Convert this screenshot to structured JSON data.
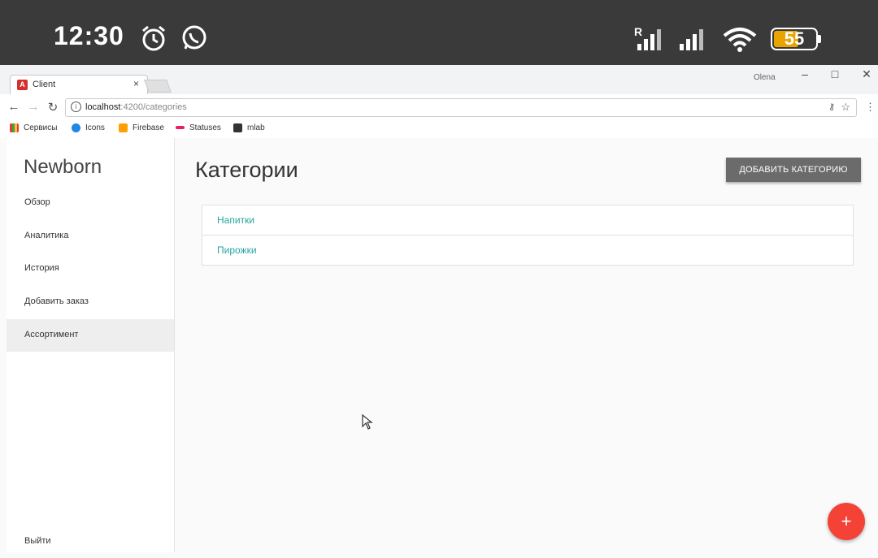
{
  "status_bar": {
    "time": "12:30",
    "battery": "55",
    "icons": [
      "alarm-icon",
      "whatsapp-icon",
      "signal-r-icon",
      "signal-icon",
      "wifi-icon",
      "battery-icon"
    ],
    "battery_color": "#e9a400"
  },
  "browser": {
    "tab_title": "Client",
    "tab_close": "×",
    "window_user": "Olena",
    "url_host": "localhost",
    "url_path": ":4200/categories",
    "bookmarks": [
      "Сервисы",
      "Icons",
      "Firebase",
      "Statuses",
      "mlab"
    ]
  },
  "sidebar": {
    "brand": "Newborn",
    "items": [
      {
        "label": "Обзор"
      },
      {
        "label": "Аналитика"
      },
      {
        "label": "История"
      },
      {
        "label": "Добавить заказ"
      },
      {
        "label": "Ассортимент"
      }
    ],
    "logout": "Выйти"
  },
  "main": {
    "title": "Категории",
    "add_button": "ДОБАВИТЬ КАТЕГОРИЮ",
    "categories": [
      {
        "name": "Напитки"
      },
      {
        "name": "Пирожки"
      }
    ],
    "fab_label": "+"
  },
  "colors": {
    "accent": "#26a69a",
    "fab": "#f44336",
    "button": "#6b6b6b",
    "status_bar": "#3a3a3a"
  }
}
